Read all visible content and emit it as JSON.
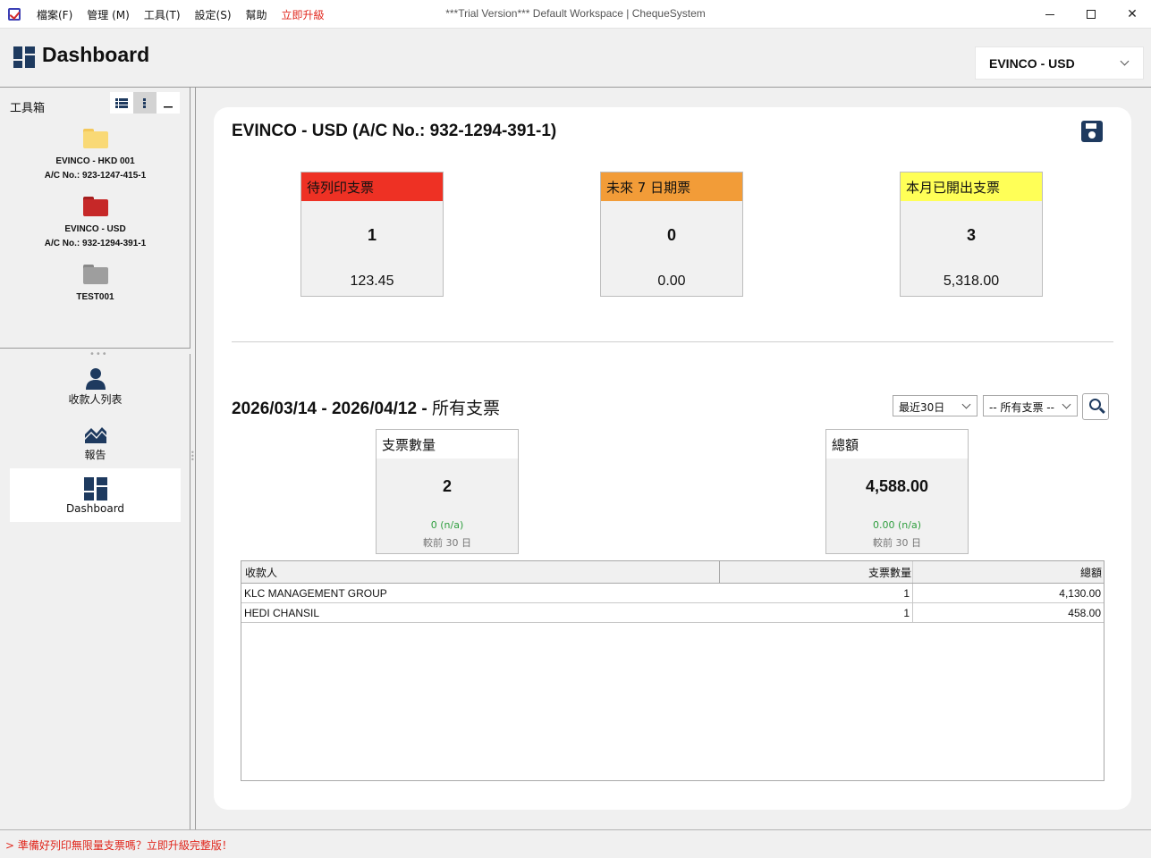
{
  "window": {
    "title": "***Trial Version*** Default Workspace | ChequeSystem",
    "menu": [
      "檔案(F)",
      "管理 (M)",
      "工具(T)",
      "設定(S)",
      "幫助",
      "立即升級"
    ]
  },
  "header": {
    "title": "Dashboard",
    "account_selected": "EVINCO - USD"
  },
  "toolbox": {
    "title": "工具箱",
    "accounts": [
      {
        "name": "EVINCO - HKD 001",
        "ac": "A/C No.: 923-1247-415-1",
        "color": "#f9d976"
      },
      {
        "name": "EVINCO - USD",
        "ac": "A/C No.: 932-1294-391-1",
        "color": "#c62828"
      },
      {
        "name": "TEST001",
        "ac": "",
        "color": "#9e9e9e"
      }
    ]
  },
  "nav": {
    "items": [
      {
        "label": "收款人列表",
        "icon": "person-icon"
      },
      {
        "label": "報告",
        "icon": "chart-icon"
      },
      {
        "label": "Dashboard",
        "icon": "dashboard-icon"
      }
    ]
  },
  "main": {
    "account_heading": "EVINCO - USD (A/C No.: 932-1294-391-1)",
    "stats": [
      {
        "header": "待列印支票",
        "count": "1",
        "amount": "123.45",
        "color": "#ee3124"
      },
      {
        "header": "未來 7 日期票",
        "count": "0",
        "amount": "0.00",
        "color": "#f29c38"
      },
      {
        "header": "本月已開出支票",
        "count": "3",
        "amount": "5,318.00",
        "color": "#ffff57"
      }
    ],
    "period": {
      "range": "2026/03/14 - 2026/04/12 - ",
      "type": "所有支票",
      "range_select": "最近30日",
      "type_select": "-- 所有支票 --"
    },
    "summary": {
      "count_header": "支票數量",
      "count": "2",
      "count_change": "0 (n/a)",
      "count_compare": "較前 30 日",
      "total_header": "總額",
      "total": "4,588.00",
      "total_change": "0.00 (n/a)",
      "total_compare": "較前 30 日",
      "change_color": "#2e9e3e"
    },
    "table": {
      "headers": [
        "收款人",
        "支票數量",
        "總額"
      ],
      "rows": [
        [
          "KLC MANAGEMENT GROUP",
          "1",
          "4,130.00"
        ],
        [
          "HEDI CHANSIL",
          "1",
          "458.00"
        ]
      ]
    }
  },
  "status": {
    "message": "> 準備好列印無限量支票嗎？立即升級完整版！"
  }
}
